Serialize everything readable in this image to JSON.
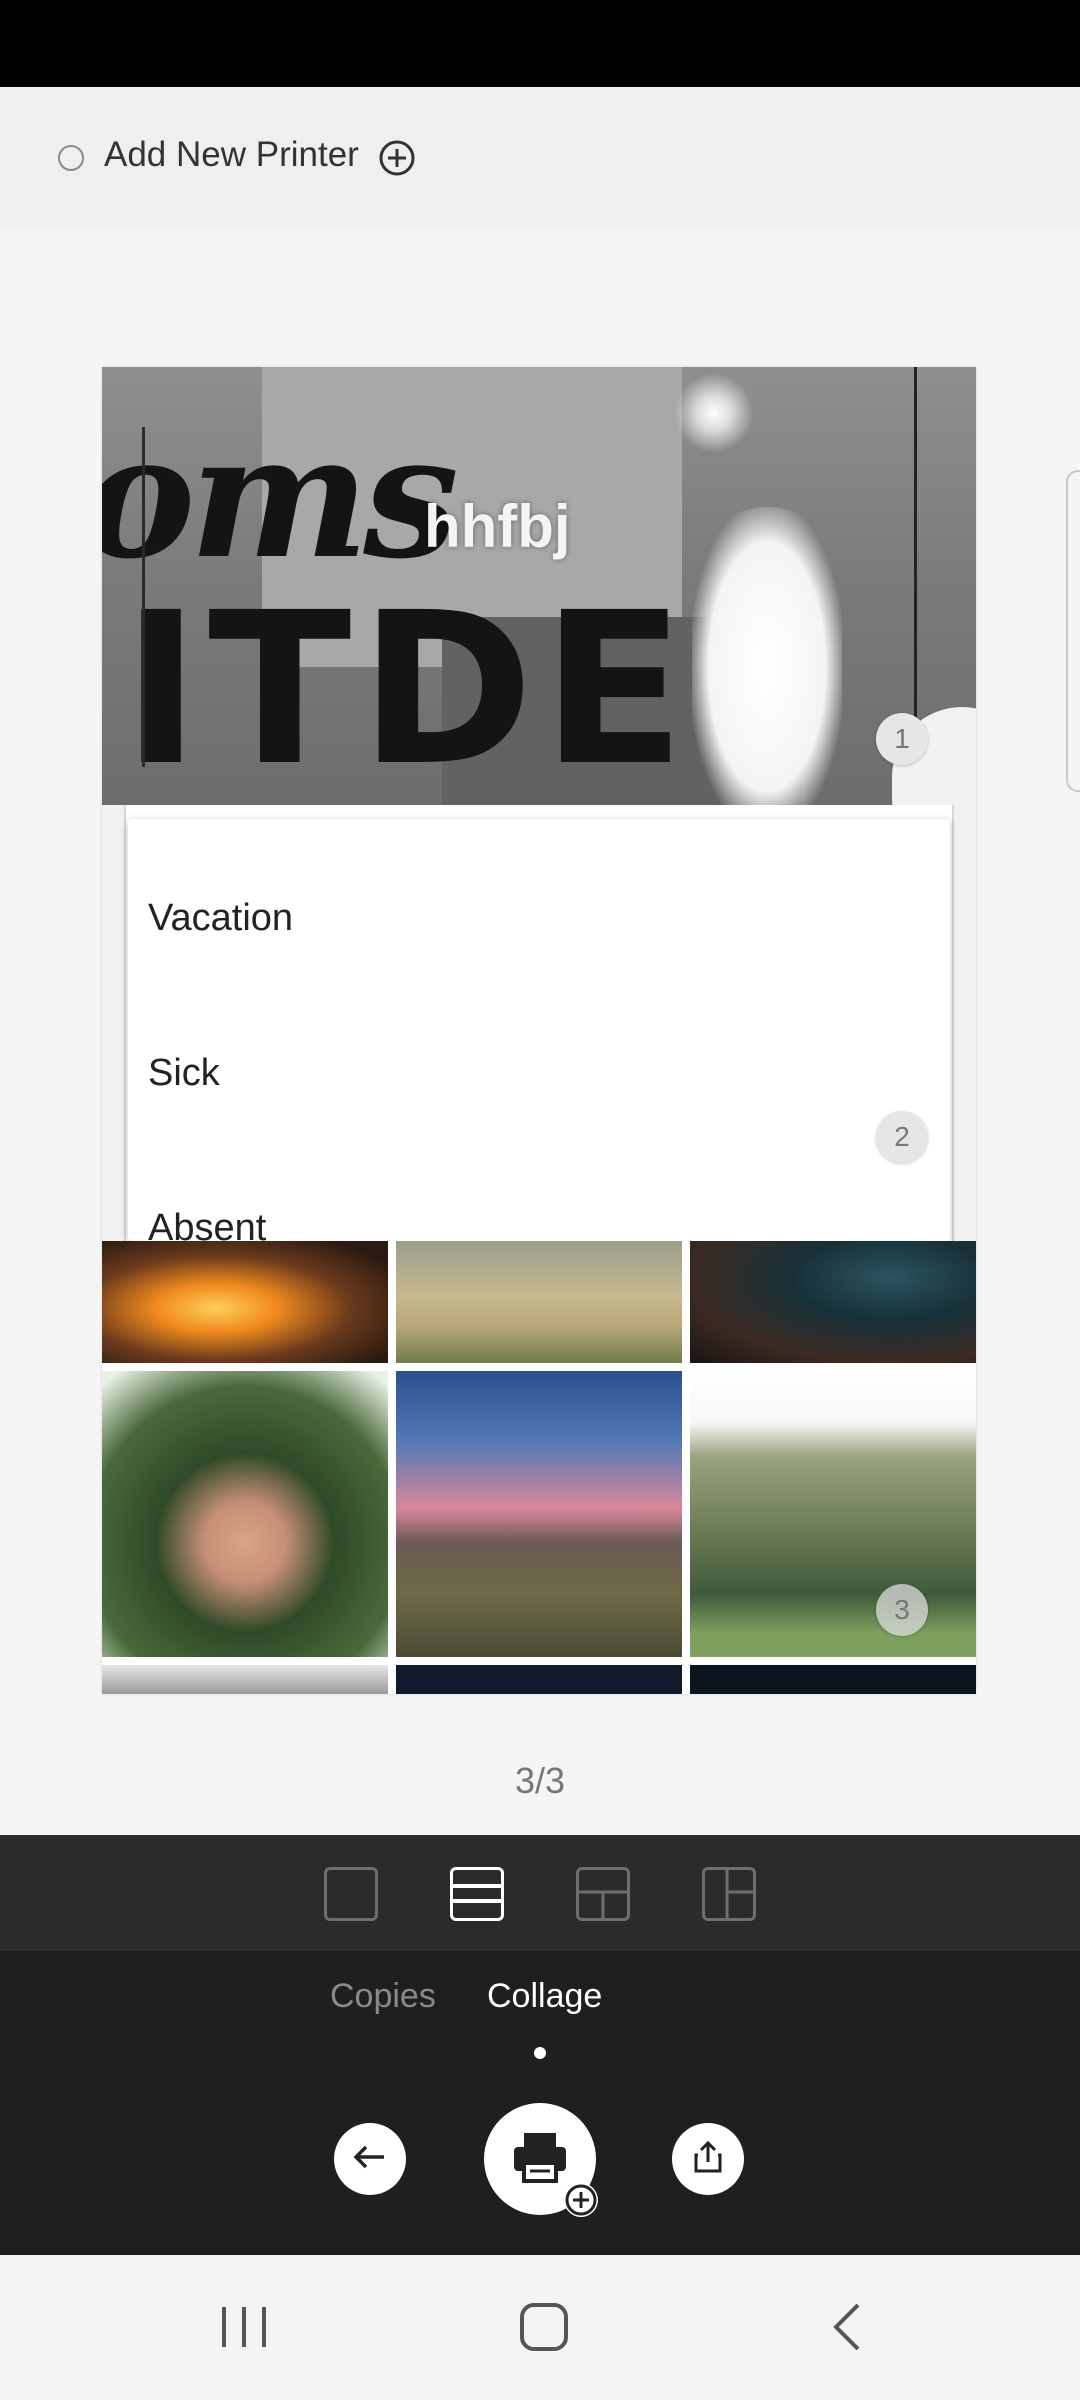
{
  "printer": {
    "add_label": "Add New Printer"
  },
  "preview": {
    "slot1_text": "hhfbj",
    "slot1_image_text_script": "oms",
    "slot1_image_text_block": "ITDE",
    "slot_numbers": [
      "1",
      "2",
      "3"
    ],
    "dropdown_options": [
      "Vacation",
      "Sick",
      "Absent"
    ]
  },
  "pagination": {
    "label": "3/3"
  },
  "tabs": {
    "copies": "Copies",
    "collage": "Collage",
    "active": "Collage"
  },
  "layouts": {
    "selected_index": 1
  },
  "colors": {
    "panel_bg": "#1f1f1f",
    "layout_row_bg": "#2b2b2b",
    "active_tab": "#ffffff",
    "inactive_tab": "#8a8a8a"
  },
  "icons": {
    "add_printer": "plus-circle-icon",
    "back": "arrow-left-icon",
    "print": "printer-icon",
    "share": "share-icon",
    "nav_recents": "recents-icon",
    "nav_home": "home-icon",
    "nav_back": "back-chevron-icon"
  }
}
